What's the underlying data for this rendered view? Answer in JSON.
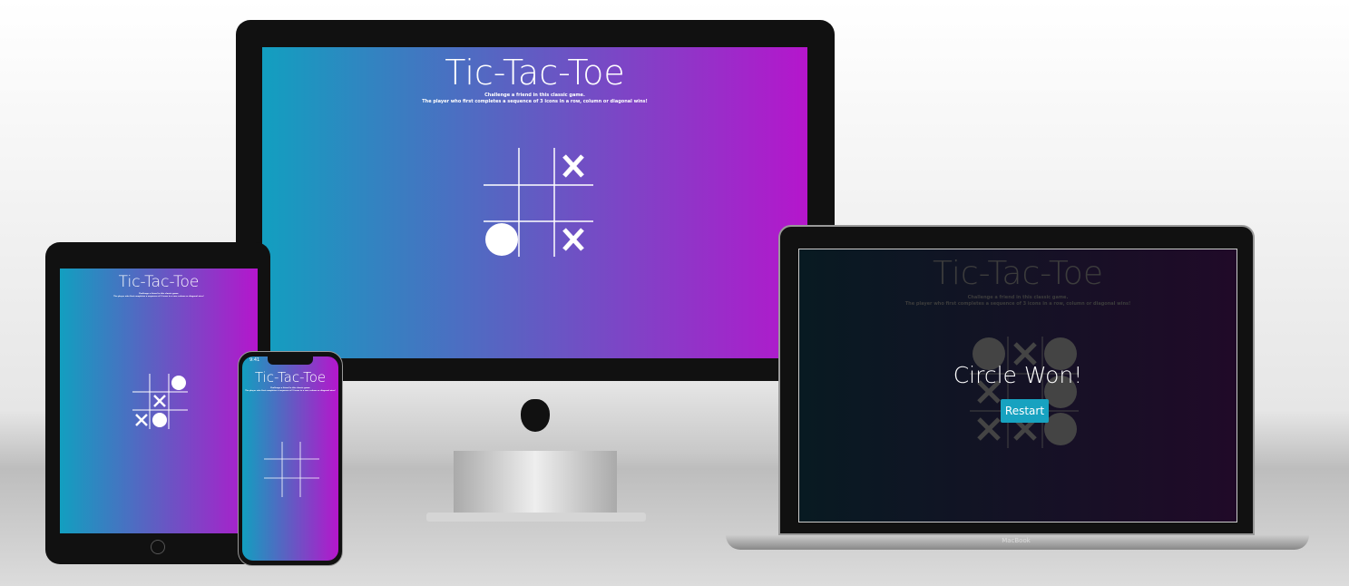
{
  "app": {
    "title": "Tic-Tac-Toe",
    "subtitle_line1": "Challenge a friend in this classic game.",
    "subtitle_line2": "The player who first completes a sequence of 3 icons in a row, column or diagonal wins!"
  },
  "desktop_board": [
    "",
    "",
    "X",
    "",
    "",
    "",
    "O",
    "",
    "X"
  ],
  "tablet_board": [
    "",
    "",
    "O",
    "",
    "X",
    "",
    "X",
    "O",
    ""
  ],
  "phone_board": [
    "",
    "",
    "",
    "",
    "",
    "",
    "",
    "",
    ""
  ],
  "phone_status": {
    "time": "9:41"
  },
  "laptop": {
    "board": [
      "O",
      "X",
      "O",
      "X",
      "",
      "O",
      "X",
      "X",
      "O"
    ],
    "result_message": "Circle Won!",
    "restart_label": "Restart",
    "brand_label": "MacBook"
  },
  "colors": {
    "gradient_start": "#129fc0",
    "gradient_end": "#b516cc",
    "button": "#17a2c0"
  }
}
